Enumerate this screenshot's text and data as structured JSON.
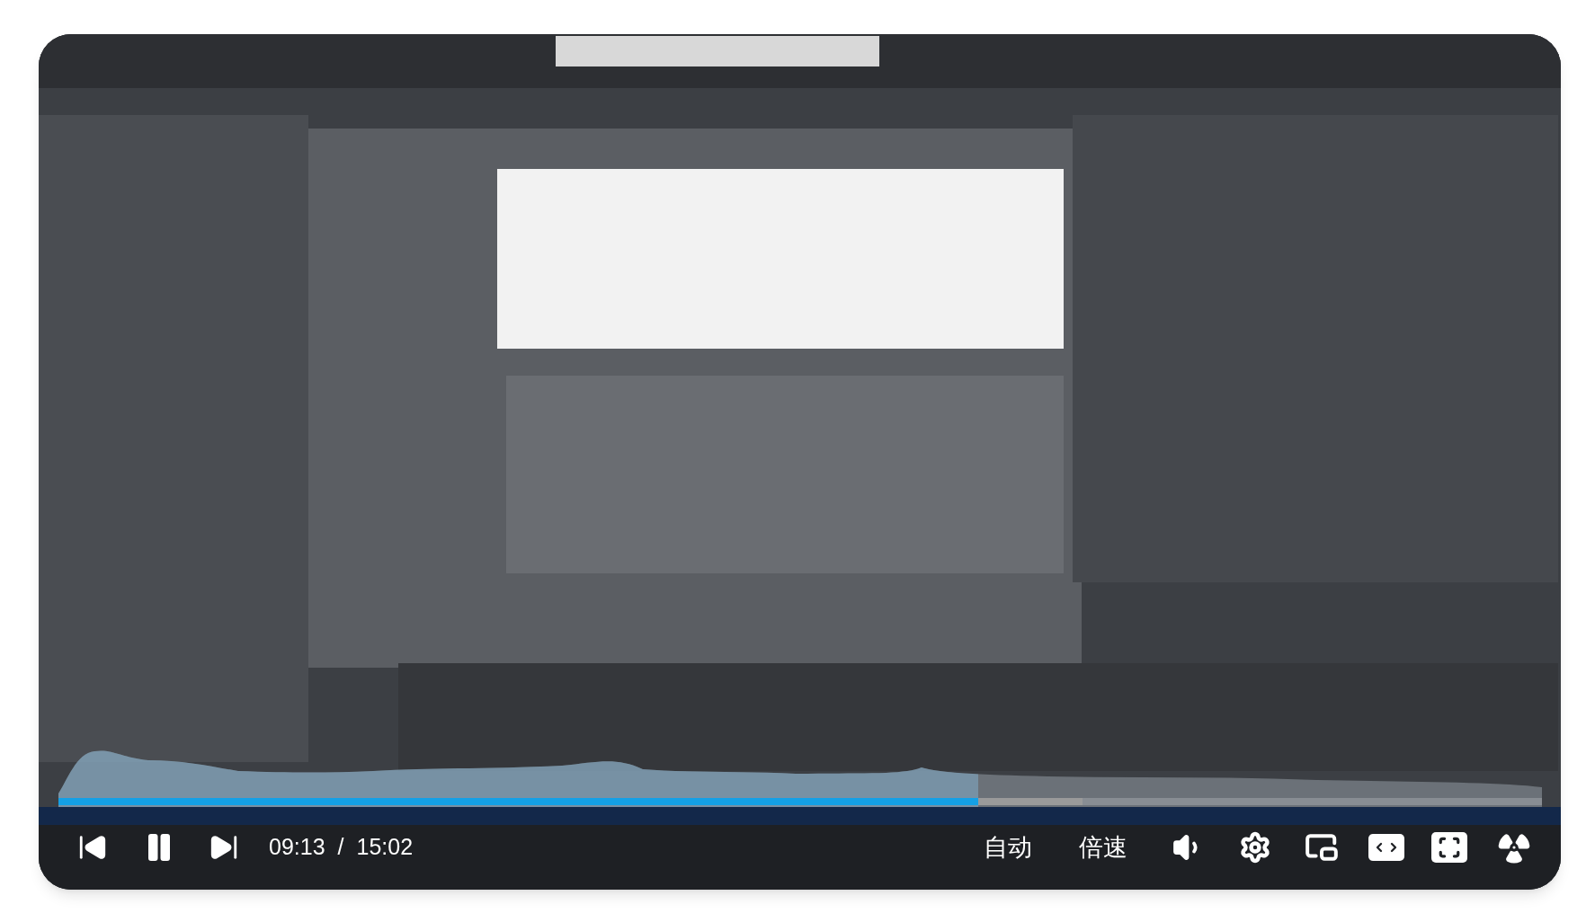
{
  "player": {
    "progress": {
      "level": 0.62
    },
    "buffer": {
      "level": 0.69
    },
    "time": {
      "current": "09:13",
      "separator": "/",
      "total": "15:02"
    },
    "quality_button": "自动",
    "speed_button": "倍速"
  }
}
